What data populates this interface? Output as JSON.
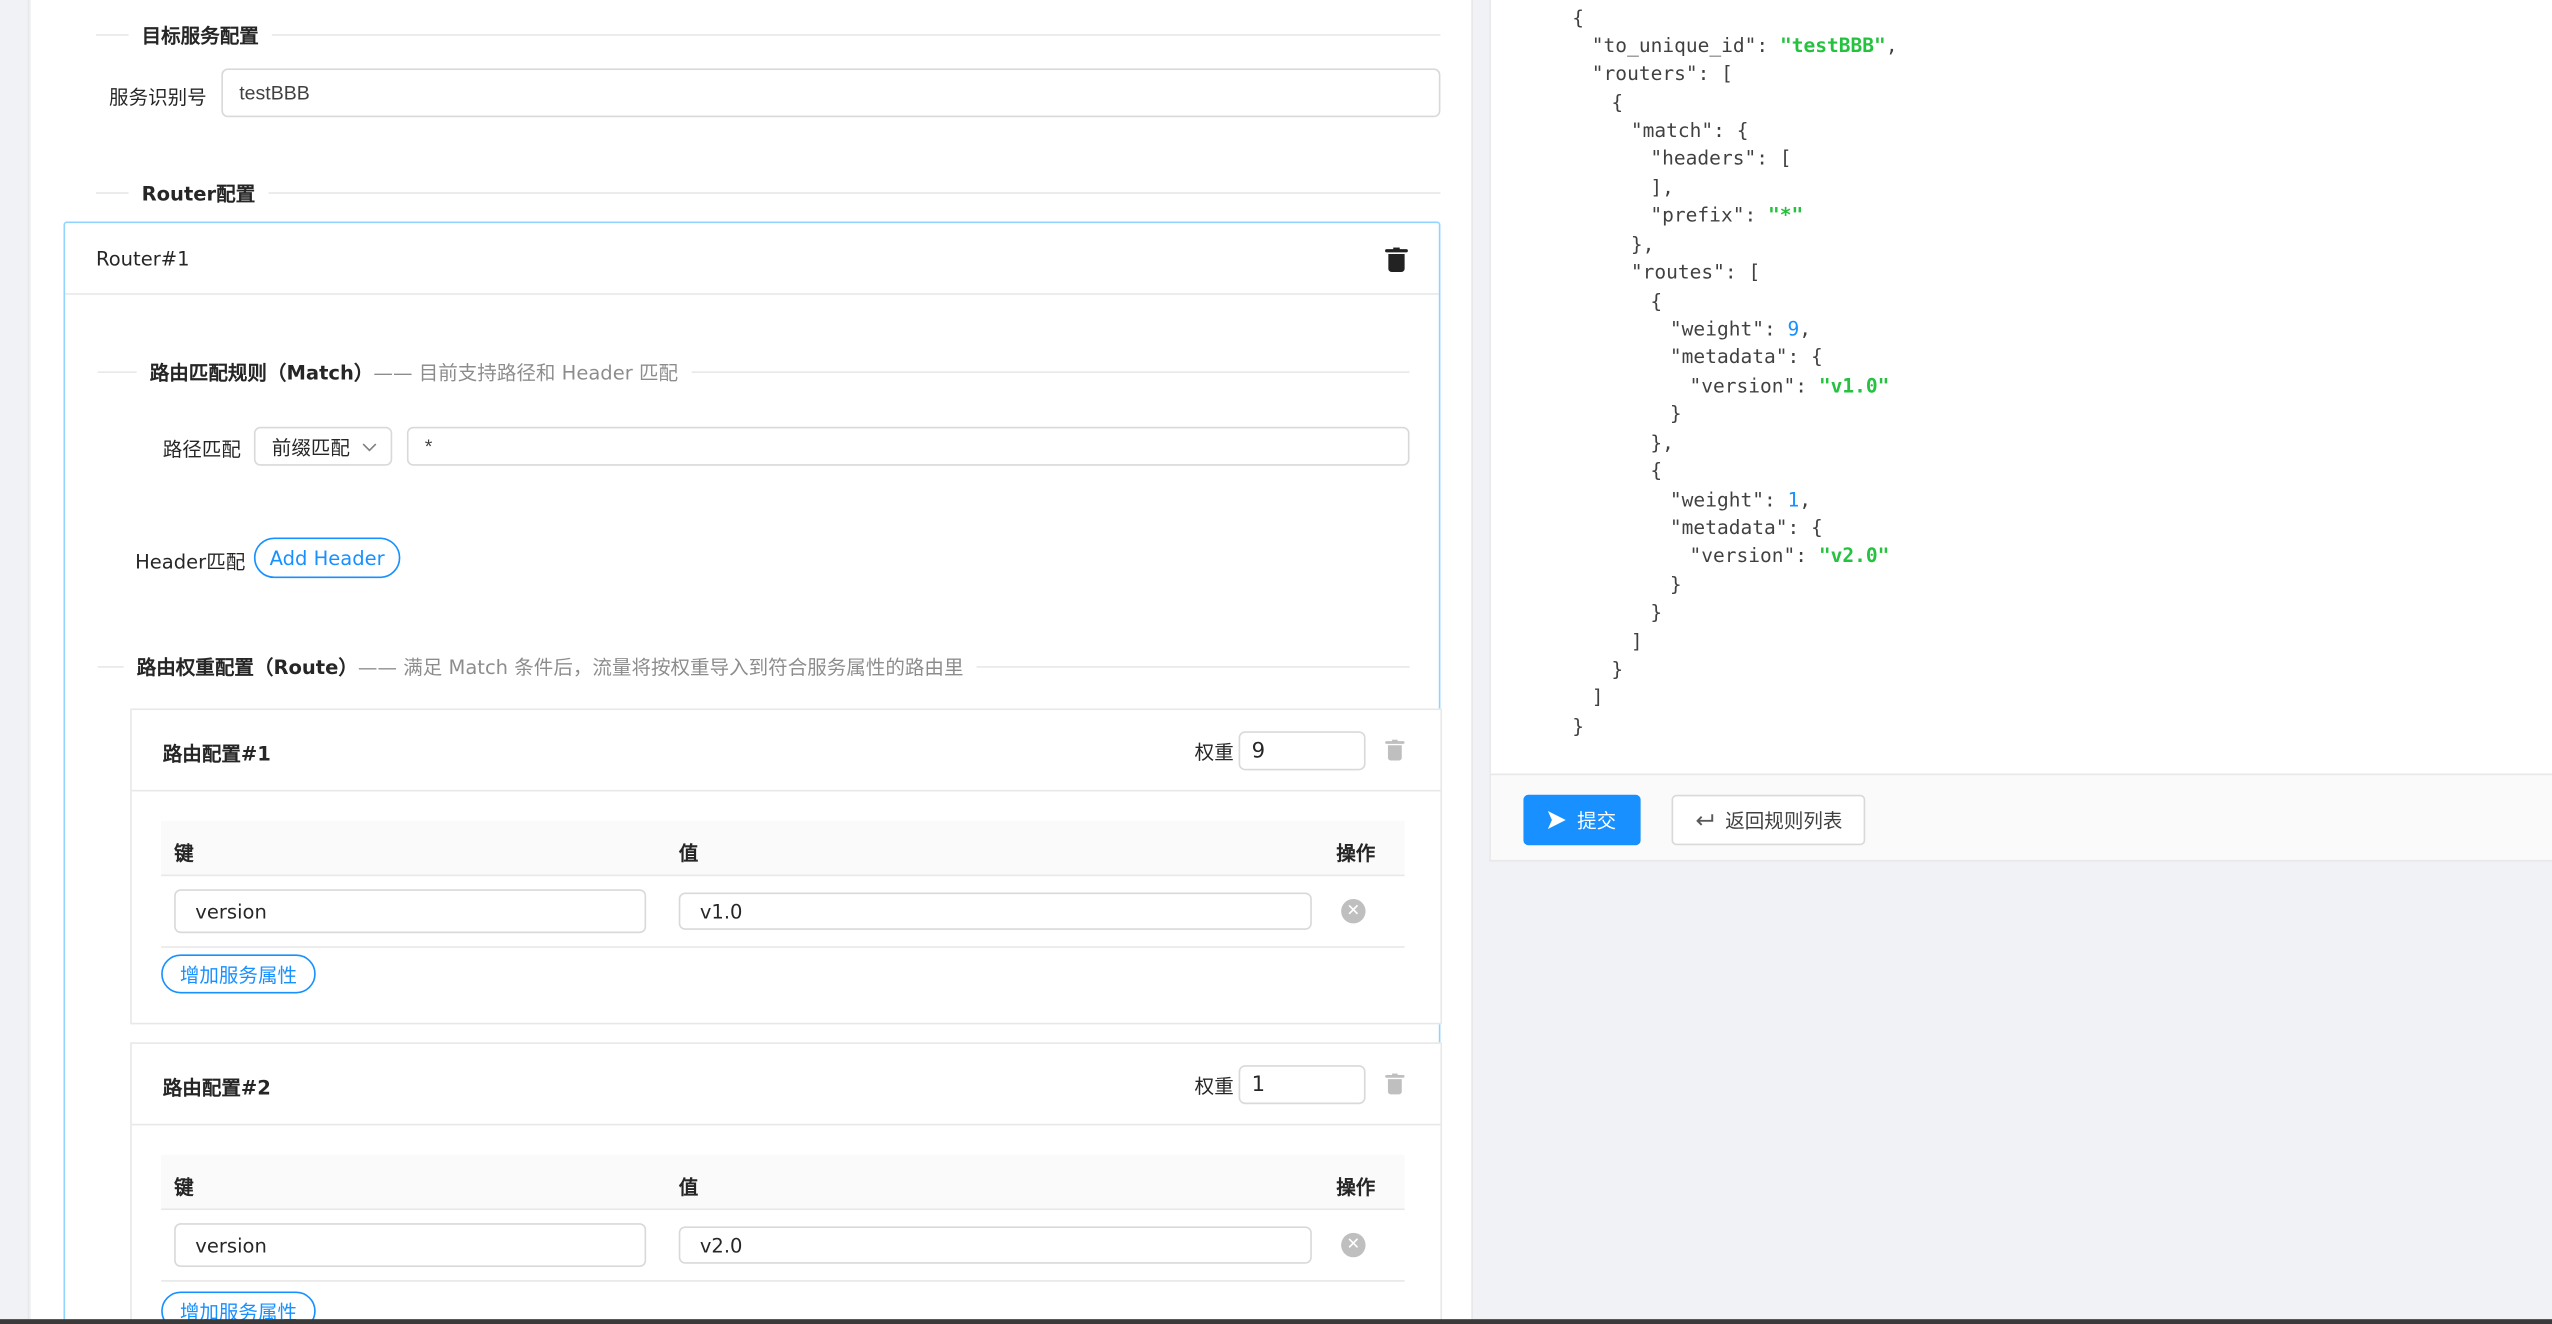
{
  "target_section": {
    "title": "目标服务配置",
    "service_id_label": "服务识别号",
    "service_id_value": "testBBB"
  },
  "router_section": {
    "title": "Router配置",
    "router_title": "Router#1",
    "match": {
      "title": "路由匹配规则（Match）",
      "subtitle": "—— 目前支持路径和 Header 匹配",
      "path_label": "路径匹配",
      "path_mode": "前缀匹配",
      "path_value": "*",
      "header_label": "Header匹配",
      "add_header": "Add Header"
    },
    "route": {
      "title": "路由权重配置（Route）",
      "subtitle": "—— 满足 Match 条件后，流量将按权重导入到符合服务属性的路由里",
      "weight_label": "权重",
      "col_key": "键",
      "col_value": "值",
      "col_action": "操作",
      "add_attr": "增加服务属性",
      "cards": [
        {
          "title": "路由配置#1",
          "weight": "9",
          "key": "version",
          "value": "v1.0"
        },
        {
          "title": "路由配置#2",
          "weight": "1",
          "key": "version",
          "value": "v2.0"
        }
      ]
    }
  },
  "json_preview": {
    "to_unique_id": "testBBB",
    "prefix": "*",
    "weight1": "9",
    "version1": "v1.0",
    "weight2": "1",
    "version2": "v2.0"
  },
  "actions": {
    "submit": "提交",
    "back": "返回规则列表"
  },
  "icons": {
    "submit": "send-icon",
    "back": "enter-return-icon",
    "delete": "trash-icon",
    "remove": "close-circle-icon"
  },
  "colors": {
    "primary": "#1890ff",
    "string": "#25c23f",
    "number": "#1890ff",
    "card_border": "#91d5ff"
  }
}
